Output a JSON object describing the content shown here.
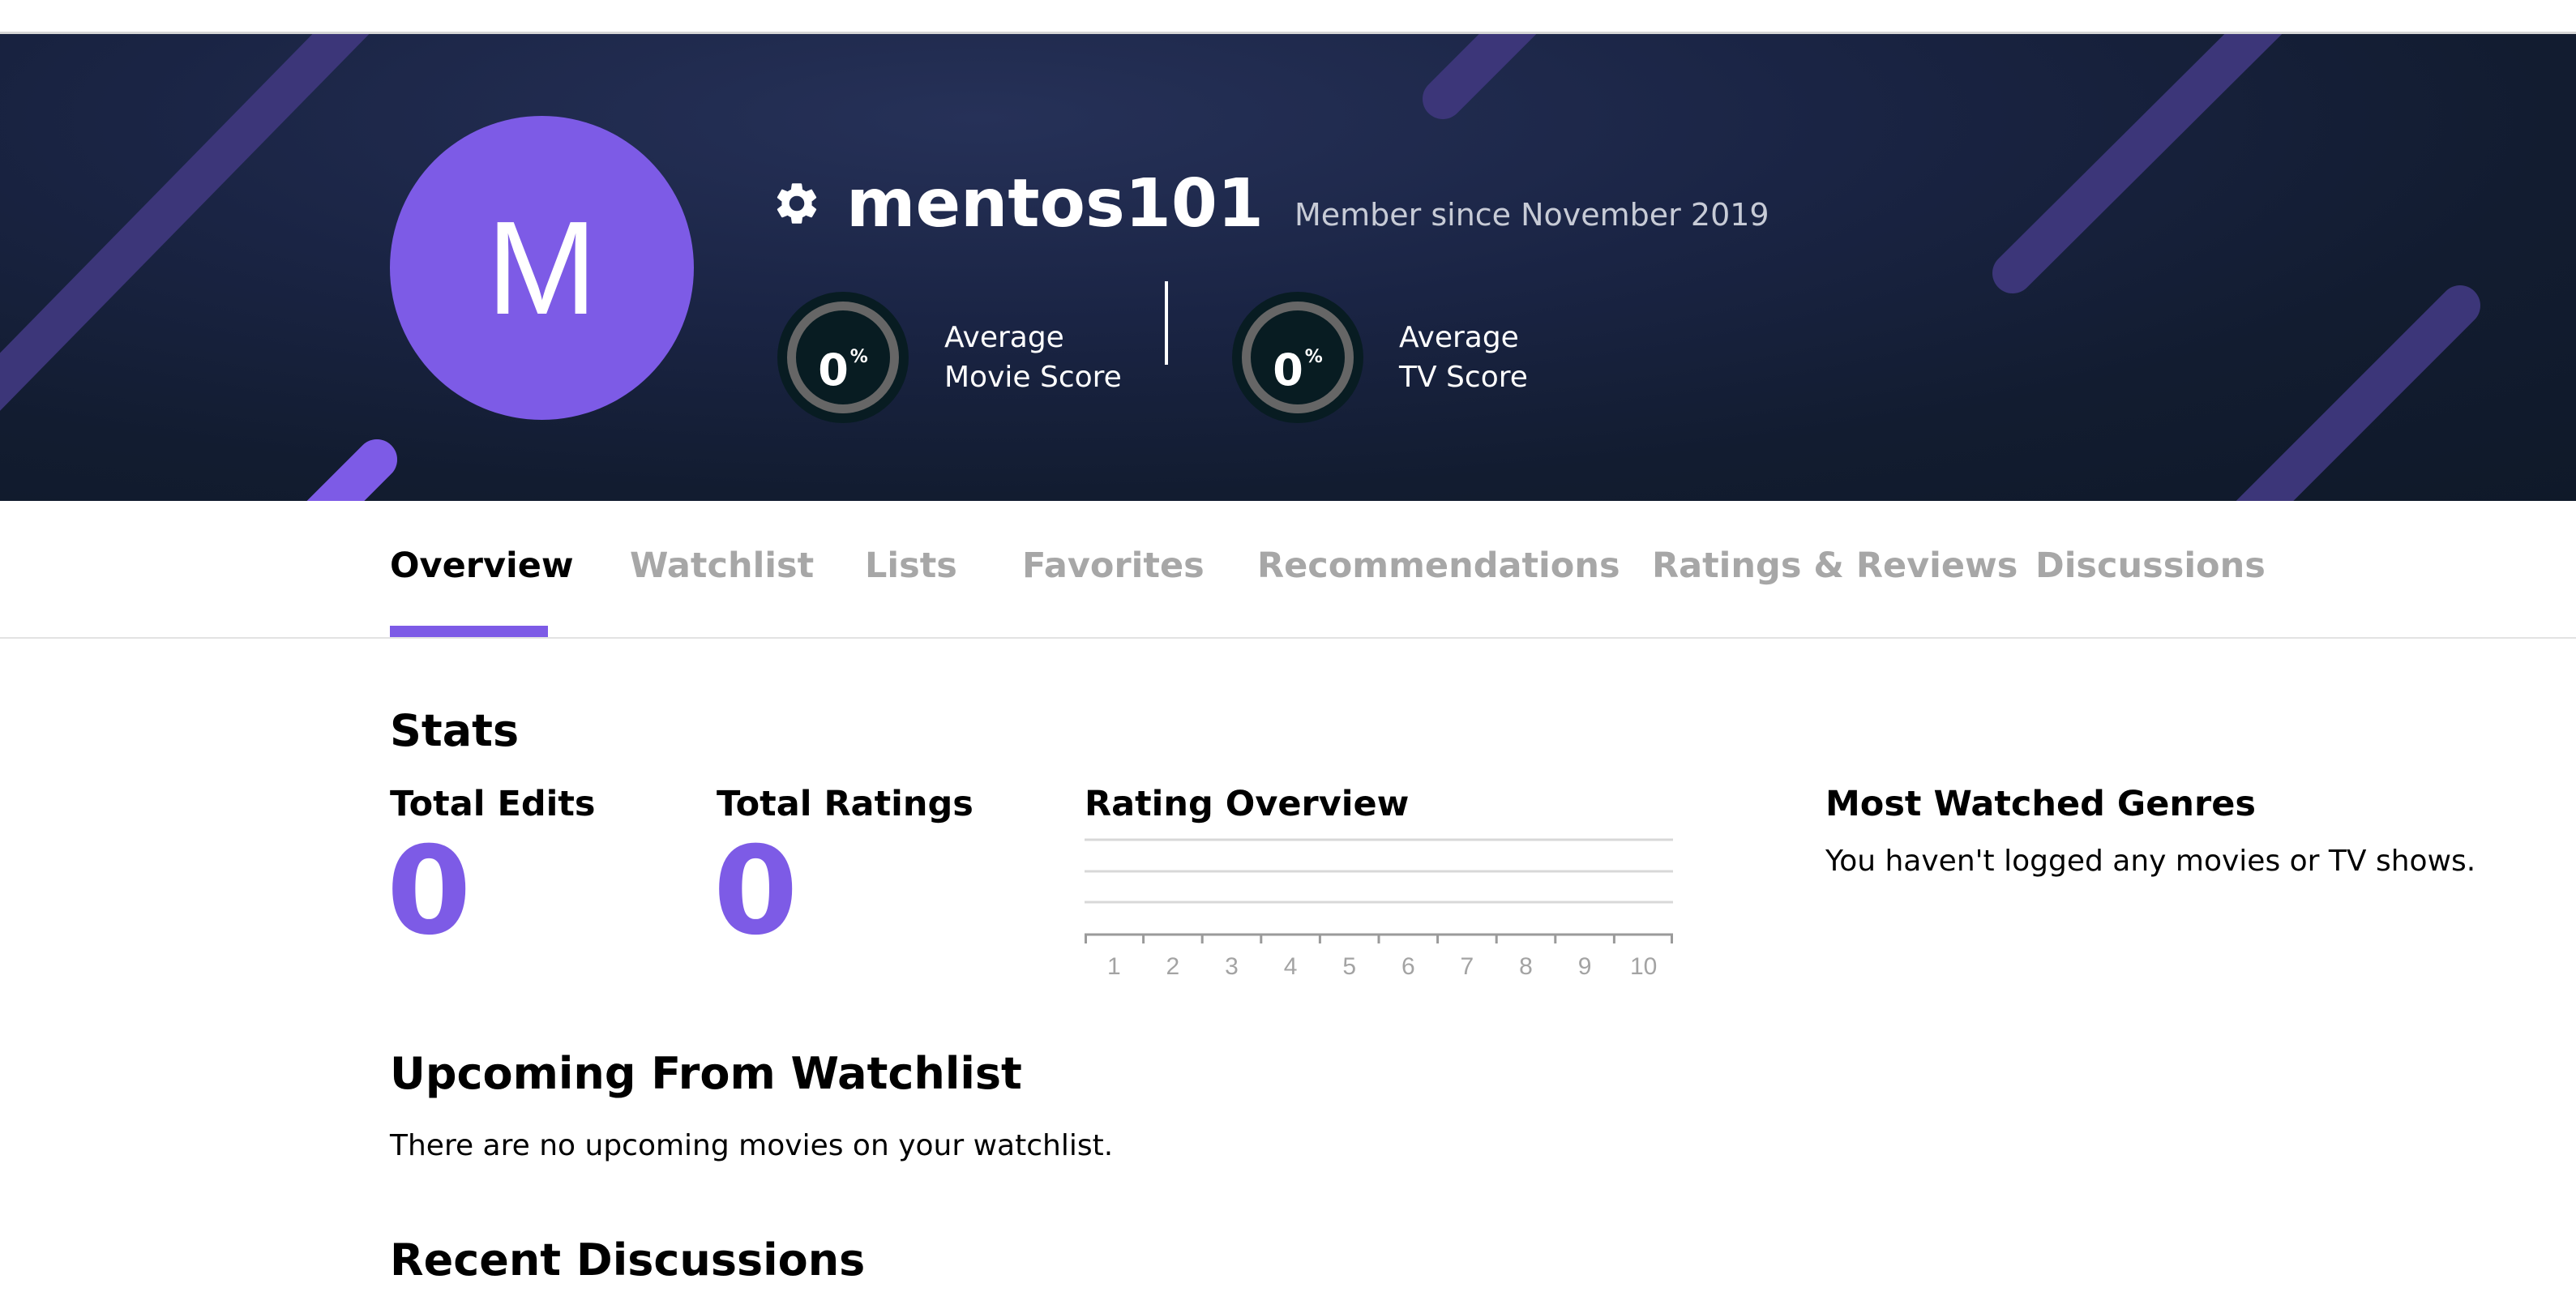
{
  "profile": {
    "avatar_letter": "M",
    "username": "mentos101",
    "member_since": "Member since November 2019",
    "movie_score": {
      "value": "0",
      "unit": "%",
      "label_line1": "Average",
      "label_line2": "Movie Score"
    },
    "tv_score": {
      "value": "0",
      "unit": "%",
      "label_line1": "Average",
      "label_line2": "TV Score"
    }
  },
  "tabs": [
    {
      "label": "Overview",
      "active": true
    },
    {
      "label": "Watchlist"
    },
    {
      "label": "Lists"
    },
    {
      "label": "Favorites"
    },
    {
      "label": "Recommendations"
    },
    {
      "label": "Ratings & Reviews"
    },
    {
      "label": "Discussions"
    }
  ],
  "stats": {
    "heading": "Stats",
    "total_edits_label": "Total Edits",
    "total_edits_value": "0",
    "total_ratings_label": "Total Ratings",
    "total_ratings_value": "0",
    "rating_overview_label": "Rating Overview",
    "rating_overview_ticks": [
      "1",
      "2",
      "3",
      "4",
      "5",
      "6",
      "7",
      "8",
      "9",
      "10"
    ],
    "most_watched_label": "Most Watched Genres",
    "most_watched_text": "You haven't logged any movies or TV shows."
  },
  "upcoming": {
    "heading": "Upcoming From Watchlist",
    "text": "There are no upcoming movies on your watchlist."
  },
  "recent_discussions": {
    "heading": "Recent Discussions"
  },
  "colors": {
    "accent": "#7d5be6",
    "banner_dark": "#121c30",
    "tab_inactive": "#a7a7a7"
  }
}
